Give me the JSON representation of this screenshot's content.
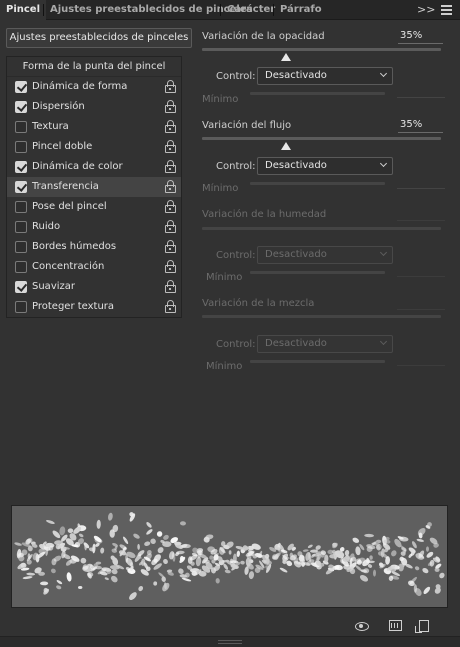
{
  "tabs": [
    {
      "label": "Pincel",
      "active": true
    },
    {
      "label": "Ajustes preestablecidos de pinceles",
      "active": false
    },
    {
      "label": "Carácter",
      "active": false
    },
    {
      "label": "Párrafo",
      "active": false
    }
  ],
  "tabbar_icons": {
    "expand": ">>",
    "menu": "hamburger-menu-icon"
  },
  "preset_button": {
    "label": "Ajustes preestablecidos de pinceles"
  },
  "brush_options": {
    "header": "Forma de la punta del pincel",
    "items": [
      {
        "label": "Dinámica de forma",
        "checked": true,
        "selected": false
      },
      {
        "label": "Dispersión",
        "checked": true,
        "selected": false
      },
      {
        "label": "Textura",
        "checked": false,
        "selected": false
      },
      {
        "label": "Pincel doble",
        "checked": false,
        "selected": false
      },
      {
        "label": "Dinámica de color",
        "checked": true,
        "selected": false
      },
      {
        "label": "Transferencia",
        "checked": true,
        "selected": true
      },
      {
        "label": "Pose del pincel",
        "checked": false,
        "selected": false
      },
      {
        "label": "Ruido",
        "checked": false,
        "selected": false
      },
      {
        "label": "Bordes húmedos",
        "checked": false,
        "selected": false
      },
      {
        "label": "Concentración",
        "checked": false,
        "selected": false
      },
      {
        "label": "Suavizar",
        "checked": true,
        "selected": false
      },
      {
        "label": "Proteger textura",
        "checked": false,
        "selected": false
      }
    ]
  },
  "settings": {
    "opacity": {
      "label": "Variación de la opacidad",
      "value": "35%",
      "slider_fraction": 0.35,
      "control_label": "Control:",
      "control_value": "Desactivado",
      "min_label": "Mínimo",
      "enabled": true
    },
    "flow": {
      "label": "Variación del flujo",
      "value": "35%",
      "slider_fraction": 0.35,
      "control_label": "Control:",
      "control_value": "Desactivado",
      "min_label": "Mínimo",
      "enabled": true
    },
    "wetness": {
      "label": "Variación de la humedad",
      "control_label": "Control:",
      "control_value": "Desactivado",
      "min_label": "Mínimo",
      "enabled": false
    },
    "mix": {
      "label": "Variación de la mezcla",
      "control_label": "Control:",
      "control_value": "Desactivado",
      "min_label": "Mínimo",
      "enabled": false
    }
  },
  "bottom_icons": [
    "toggle-live-tip-preview-icon",
    "brush-projection-icon",
    "create-new-brush-icon"
  ],
  "colors": {
    "panel": "#323232",
    "tabbar": "#262626",
    "preview_bg": "#5f5f5f",
    "text": "#cfcfcf"
  }
}
